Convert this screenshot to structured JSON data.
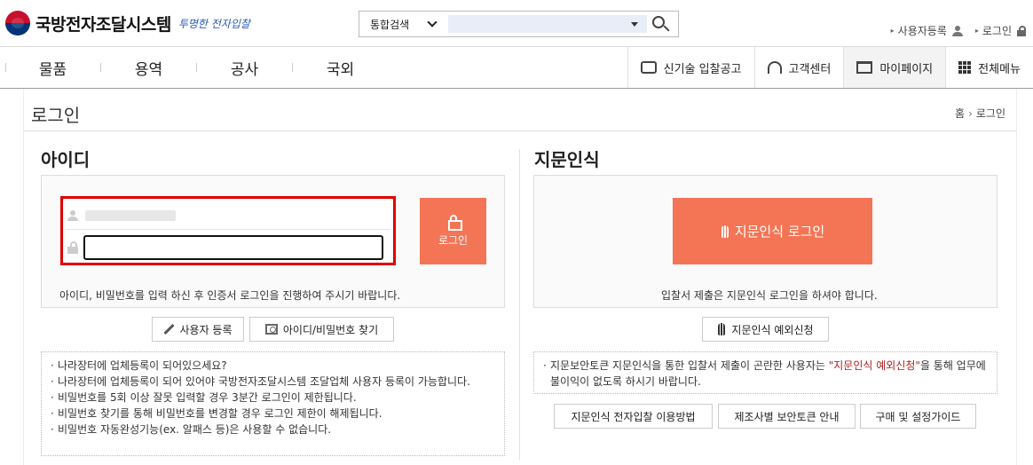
{
  "header": {
    "logo_text": "국방전자조달시스템",
    "slogan": "투명한 전자입찰",
    "search_scope": "통합검색",
    "search_value": "",
    "user_register": "사용자등록",
    "login": "로그인"
  },
  "nav": {
    "main": [
      "물품",
      "용역",
      "공사",
      "국외"
    ],
    "right": [
      {
        "label": "신기술 입찰공고",
        "icon": "newtech-icon"
      },
      {
        "label": "고객센터",
        "icon": "headset-icon"
      },
      {
        "label": "마이페이지",
        "icon": "box-icon"
      },
      {
        "label": "전체메뉴",
        "icon": "grid-icon"
      }
    ]
  },
  "page": {
    "title": "로그인",
    "breadcrumb_home": "홈",
    "breadcrumb_current": "로그인"
  },
  "id_login": {
    "section_title": "아이디",
    "id_value": "",
    "password_value": "",
    "login_button": "로그인",
    "notice": "아이디, 비밀번호를 입력 하신 후 인증서 로그인을 진행하여 주시기 바랍니다.",
    "register_button": "사용자 등록",
    "find_button": "아이디/비밀번호 찾기",
    "info": [
      "나라장터에 업체등록이 되어있으세요?",
      "나라장터에 업체등록이 되어 있어야 국방전자조달시스템 조달업체 사용자 등록이 가능합니다.",
      "비밀번호를 5회 이상 잘못 입력할 경우 3분간 로그인이 제한됩니다.",
      "비밀번호 찾기를 통해 비밀번호를 변경할 경우 로그인 제한이 해제됩니다.",
      "비밀번호 자동완성기능(ex. 알패스 등)은 사용할 수 없습니다."
    ]
  },
  "finger_login": {
    "section_title": "지문인식",
    "login_button": "지문인식 로그인",
    "notice": "입찰서 제출은 지문인식 로그인을 하셔야 합니다.",
    "exception_button": "지문인식 예외신청",
    "info_prefix": "지문보안토큰 지문인식을 통한 입찰서 제출이 곤란한 사용자는 ",
    "info_highlight": "\"지문인식 예외신청\"",
    "info_suffix": "을 통해 업무에 불이익이 없도록 하시기 바랍니다.",
    "guide_buttons": [
      "지문인식 전자입찰 이용방법",
      "제조사별 보안토큰 안내",
      "구매 및 설정가이드"
    ]
  },
  "colors": {
    "accent": "#f47555",
    "highlight_frame": "#e00000"
  }
}
